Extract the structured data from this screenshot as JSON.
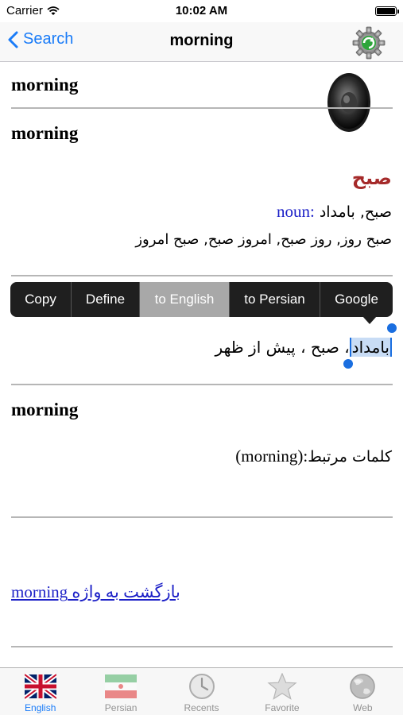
{
  "status_bar": {
    "carrier": "Carrier",
    "time": "10:02 AM",
    "battery_level": 1.0
  },
  "nav": {
    "back_label": "Search",
    "title": "morning",
    "refresh_icon": "gear-refresh-icon"
  },
  "entry": {
    "headword": "morning",
    "speaker_icon": "speaker-icon",
    "headword2": "morning",
    "persian_head": "صبح",
    "part_of_speech": "noun:",
    "meanings": "صبح, بامداد",
    "examples": "صبح روز, روز صبح, امروز صبح, صبح امروز"
  },
  "popup_menu": {
    "items": [
      "Copy",
      "Define",
      "to English",
      "to Persian",
      "Google"
    ],
    "selected": "to English"
  },
  "selection": {
    "selected_word": "بامداد",
    "rest": "، صبح ، پیش از ظهر"
  },
  "related": {
    "headword": "morning",
    "label_latin": ":(morning)",
    "label_persian": "کلمات مرتبط"
  },
  "back_link": "بازگشت به واژه morning",
  "tab_bar": {
    "tabs": [
      {
        "label": "English",
        "icon": "uk-flag-icon",
        "active": true
      },
      {
        "label": "Persian",
        "icon": "iran-flag-icon",
        "active": false
      },
      {
        "label": "Recents",
        "icon": "clock-icon",
        "active": false
      },
      {
        "label": "Favorite",
        "icon": "star-icon",
        "active": false
      },
      {
        "label": "Web",
        "icon": "globe-icon",
        "active": false
      }
    ]
  },
  "colors": {
    "accent": "#1a7cf8",
    "persian_heading": "#a52a2a",
    "link": "#1b1fc7",
    "selection": "#c8dcf5"
  }
}
